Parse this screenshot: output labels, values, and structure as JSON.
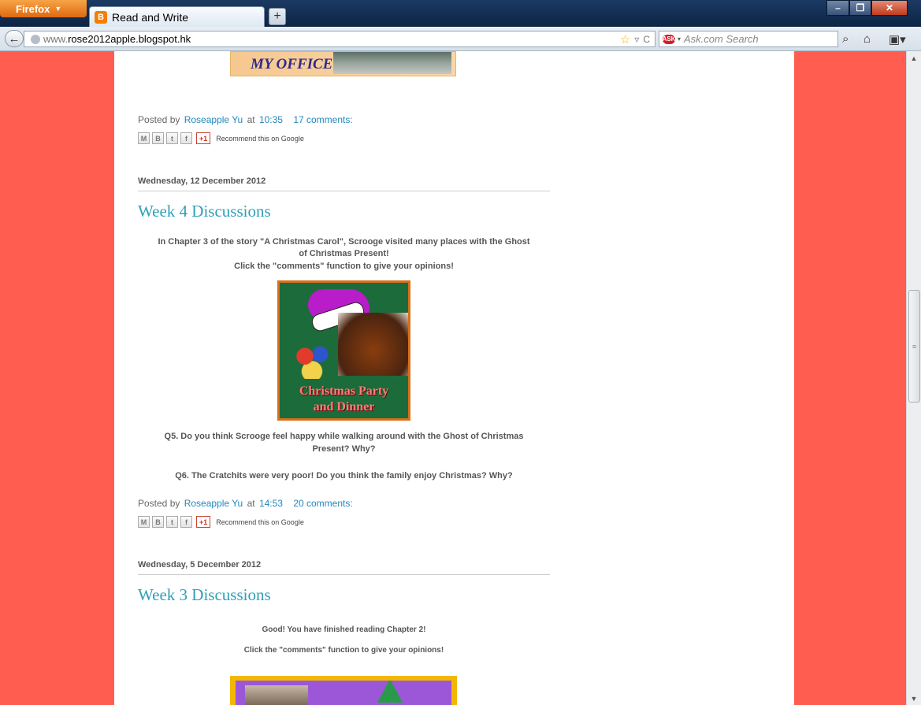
{
  "browser": {
    "menu_button": "Firefox",
    "tab_title": "Read and Write",
    "url_host": "rose2012apple.blogspot.hk",
    "url_prefix": "www.",
    "search_placeholder": "Ask.com Search"
  },
  "posts": [
    {
      "image_label": "MY OFFICE",
      "posted_prefix": "Posted by",
      "author": "Roseapple Yu",
      "at": "at",
      "time": "10:35",
      "comments": "17 comments:",
      "recommend": "Recommend this on Google",
      "plusone": "+1"
    },
    {
      "date": "Wednesday, 12 December 2012",
      "title": "Week 4 Discussions",
      "intro_line1": "In Chapter 3 of the story \"A Christmas Carol\", Scrooge visited many places with the Ghost",
      "intro_line2": "of Christmas Present!",
      "intro_line3": "Click the \"comments\" function to give your opinions!",
      "image_text_line1": "Christmas Party",
      "image_text_line2": "and Dinner",
      "q5_line1": "Q5. Do you think Scrooge feel happy while walking around with the Ghost of Christmas",
      "q5_line2": "Present? Why?",
      "q6": "Q6. The Cratchits were very poor! Do you think the family enjoy Christmas? Why?",
      "posted_prefix": "Posted by",
      "author": "Roseapple Yu",
      "at": "at",
      "time": "14:53",
      "comments": "20 comments:",
      "recommend": "Recommend this on Google",
      "plusone": "+1"
    },
    {
      "date": "Wednesday, 5 December 2012",
      "title": "Week 3 Discussions",
      "line1": "Good! You have finished reading Chapter 2!",
      "line2": "Click the \"comments\" function to give your opinions!"
    }
  ],
  "colors": {
    "page_background": "#ff5d4f",
    "title_link": "#2e9fb6",
    "link": "#2288bb"
  }
}
